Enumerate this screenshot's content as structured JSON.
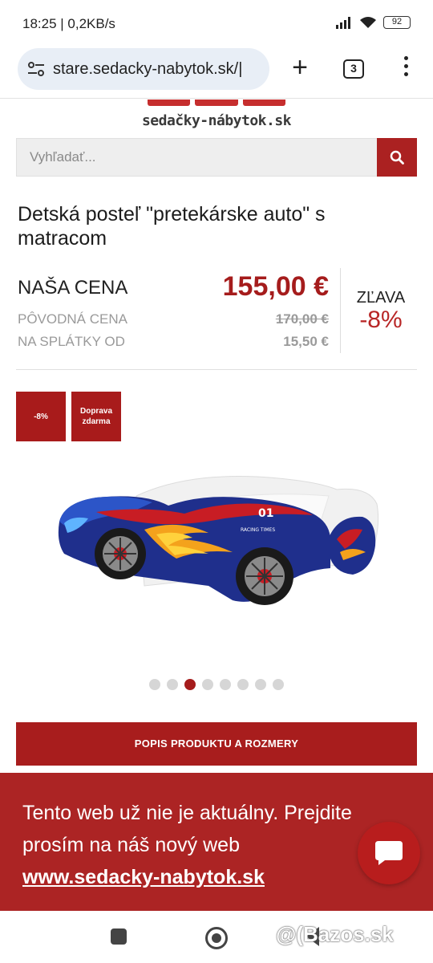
{
  "status_bar": {
    "time_speed": "18:25 | 0,2KB/s",
    "battery": "92"
  },
  "browser": {
    "url": "stare.sedacky-nabytok.sk/|",
    "tab_count": "3",
    "new_tab_label": "+"
  },
  "site": {
    "logo_text": "sedačky-nábytok.sk"
  },
  "search": {
    "placeholder": "Vyhľadať..."
  },
  "product": {
    "title": "Detská posteľ \"pretekárske auto\" s matracom",
    "our_price_label": "NAŠA CENA",
    "our_price": "155,00 €",
    "original_price_label": "PÔVODNÁ CENA",
    "original_price": "170,00 €",
    "installment_label": "NA SPLÁTKY OD",
    "installment_price": "15,50 €",
    "discount_label": "ZĽAVA",
    "discount_value": "-8%"
  },
  "badges": [
    {
      "text": "-8%"
    },
    {
      "text": "Doprava zdarma"
    }
  ],
  "car_graphics": {
    "number_text": "01",
    "brand_text": "RACING TIMES"
  },
  "gallery": {
    "total": 8,
    "active_index": 2
  },
  "description_button": "POPIS PRODUKTU A ROZMERY",
  "notice": {
    "text": "Tento web už nie je aktuálny. Prejdite prosím na náš nový web",
    "link": "www.sedacky-nabytok.sk"
  },
  "watermark": "@(Bazos.sk",
  "colors": {
    "accent": "#a81d1d",
    "price_red": "#a51c1c",
    "notice_bg": "#ac2424"
  }
}
